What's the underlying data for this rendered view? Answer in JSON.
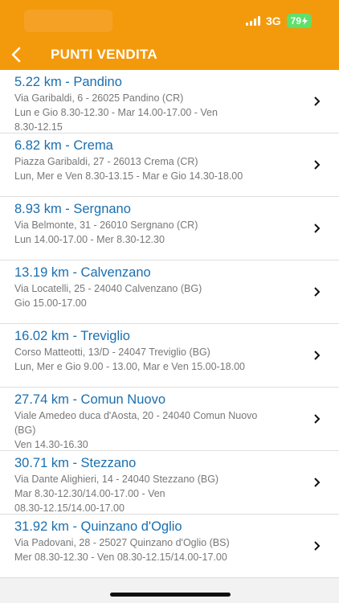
{
  "status_bar": {
    "network": "3G",
    "battery": "79"
  },
  "header": {
    "title": "PUNTI VENDITA"
  },
  "stores": [
    {
      "title": "5.22 km - Pandino",
      "address": "Via Garibaldi, 6 - 26025 Pandino (CR)",
      "hours": [
        "Lun e Gio 8.30-12.30 - Mar 14.00-17.00 - Ven",
        "8.30-12.15"
      ]
    },
    {
      "title": "6.82 km - Crema",
      "address": "Piazza Garibaldi, 27 - 26013 Crema (CR)",
      "hours": [
        "Lun, Mer e Ven 8.30-13.15 - Mar e Gio 14.30-18.00"
      ]
    },
    {
      "title": "8.93 km - Sergnano",
      "address": "Via Belmonte, 31 - 26010 Sergnano (CR)",
      "hours": [
        "Lun 14.00-17.00 - Mer 8.30-12.30"
      ]
    },
    {
      "title": "13.19 km - Calvenzano",
      "address": "Via Locatelli, 25 - 24040 Calvenzano (BG)",
      "hours": [
        "Gio 15.00-17.00"
      ]
    },
    {
      "title": "16.02 km - Treviglio",
      "address": "Corso Matteotti, 13/D - 24047 Treviglio (BG)",
      "hours": [
        "Lun, Mer e Gio 9.00 - 13.00, Mar e Ven 15.00-18.00"
      ]
    },
    {
      "title": "27.74 km - Comun Nuovo",
      "address": "Viale Amedeo duca d'Aosta, 20 - 24040 Comun Nuovo",
      "address2": "(BG)",
      "hours": [
        "Ven 14.30-16.30"
      ]
    },
    {
      "title": "30.71 km - Stezzano",
      "address": "Via Dante Alighieri, 14 - 24040 Stezzano (BG)",
      "hours": [
        "Mar 8.30-12.30/14.00-17.00 - Ven",
        "08.30-12.15/14.00-17.00"
      ]
    },
    {
      "title": "31.92 km - Quinzano d'Oglio",
      "address": "Via Padovani, 28 - 25027 Quinzano d'Oglio (BS)",
      "hours": [
        "Mer 08.30-12.30 - Ven 08.30-12.15/14.00-17.00"
      ]
    }
  ]
}
